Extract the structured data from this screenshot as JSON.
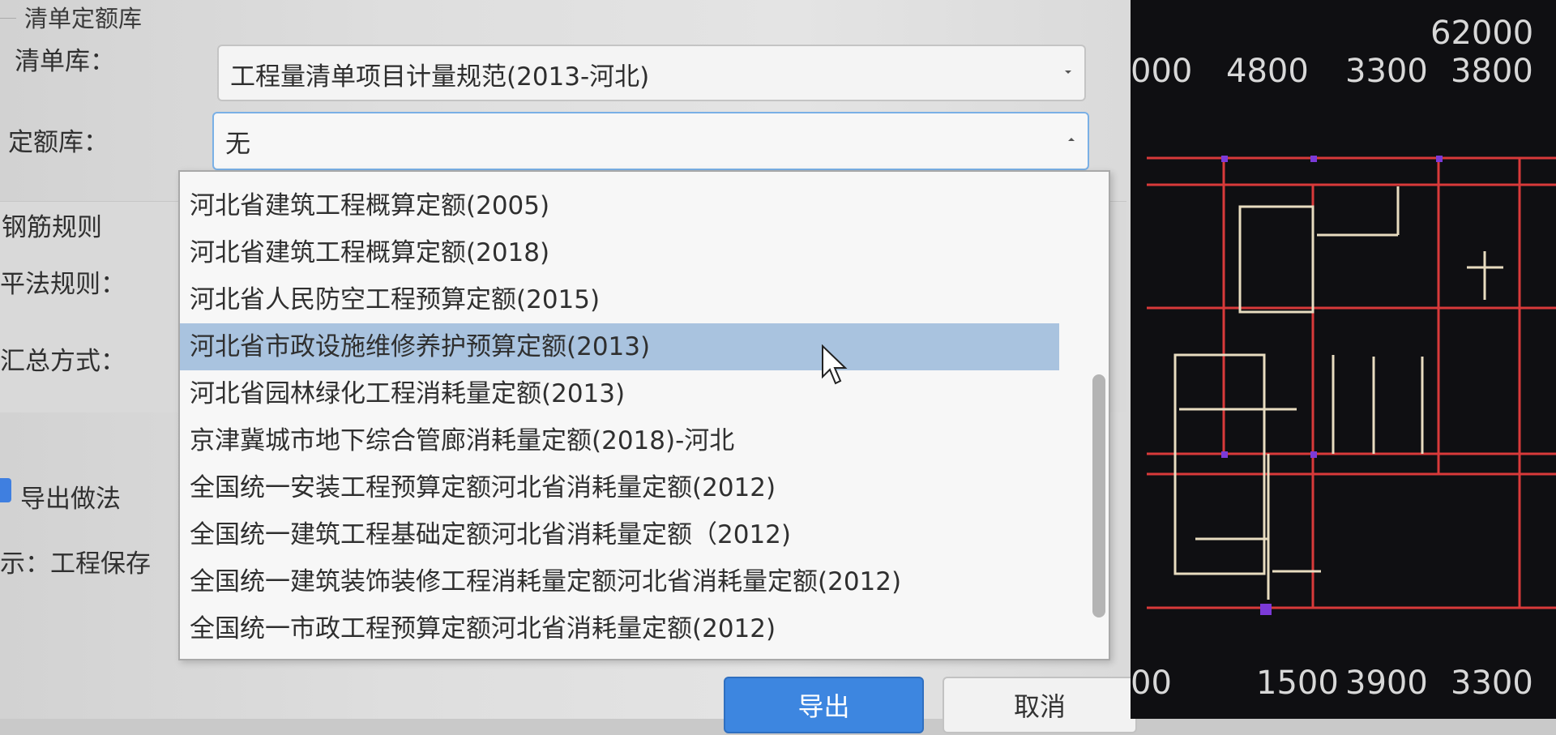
{
  "dialog": {
    "group_title": "清单定额库",
    "list_lib_label": "清单库：",
    "list_lib_value": "工程量清单项目计量规范(2013-河北)",
    "quota_lib_label": "定额库：",
    "quota_lib_value": "无",
    "rebar_rules_label": "钢筋规则",
    "flat_rule_label": "平法规则：",
    "summary_label": "汇总方式：",
    "export_method_label": "导出做法",
    "hint_label": "示：工程保存",
    "export_button": "导出",
    "cancel_button": "取消"
  },
  "dropdown": {
    "options": [
      "河北省建筑工程概算定额(2005)",
      "河北省建筑工程概算定额(2018)",
      "河北省人民防空工程预算定额(2015)",
      "河北省市政设施维修养护预算定额(2013)",
      "河北省园林绿化工程消耗量定额(2013)",
      "京津冀城市地下综合管廊消耗量定额(2018)-河北",
      "全国统一安装工程预算定额河北省消耗量定额(2012)",
      "全国统一建筑工程基础定额河北省消耗量定额（2012)",
      "全国统一建筑装饰装修工程消耗量定额河北省消耗量定额(2012)",
      "全国统一市政工程预算定额河北省消耗量定额(2012)"
    ],
    "selected_index": 3
  },
  "cad": {
    "top_dim": "62000",
    "top_row": [
      "000",
      "4800",
      "3300",
      "3800"
    ],
    "bottom_row": [
      "00",
      "1500",
      "3900",
      "3300"
    ]
  },
  "colors": {
    "selected_bg": "#a9c3df",
    "primary_button": "#3d86e0",
    "cad_background": "#0f0f12"
  }
}
